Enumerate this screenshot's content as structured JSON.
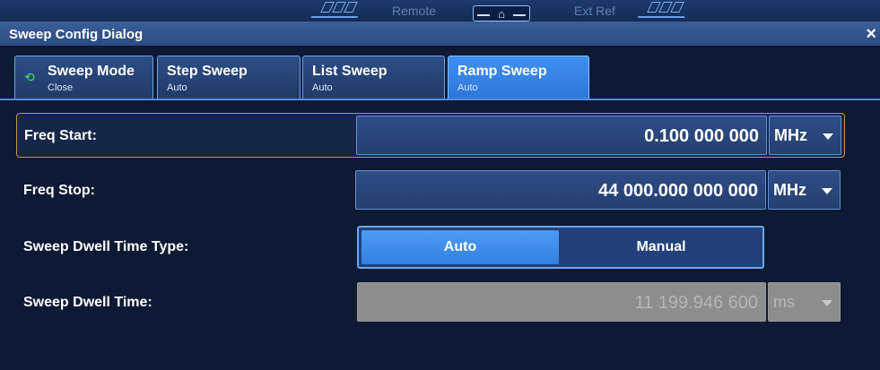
{
  "status_bar": {
    "remote": "Remote",
    "ext_ref": "Ext Ref",
    "home_icon": "home-icon"
  },
  "dialog": {
    "title": "Sweep Config Dialog",
    "close": "×"
  },
  "tabs": [
    {
      "label": "Sweep Mode",
      "sub": "Close",
      "icon": "sweep-cycle-icon",
      "active": false
    },
    {
      "label": "Step Sweep",
      "sub": "Auto",
      "active": false
    },
    {
      "label": "List Sweep",
      "sub": "Auto",
      "active": false
    },
    {
      "label": "Ramp Sweep",
      "sub": "Auto",
      "active": true
    }
  ],
  "fields": {
    "freq_start": {
      "label": "Freq Start:",
      "value": "0.100 000 000",
      "unit": "MHz"
    },
    "freq_stop": {
      "label": "Freq Stop:",
      "value": "44 000.000 000 000",
      "unit": "MHz"
    },
    "dwell_type": {
      "label": "Sweep Dwell Time Type:",
      "options": [
        "Auto",
        "Manual"
      ],
      "selected": "Auto"
    },
    "dwell_time": {
      "label": "Sweep Dwell Time:",
      "value": "11 199.946 600",
      "unit": "ms",
      "disabled": true
    }
  },
  "colors": {
    "accent": "#3a8aef",
    "selected_border": "#c8944b",
    "sweep_icon": "#3ee45f"
  }
}
